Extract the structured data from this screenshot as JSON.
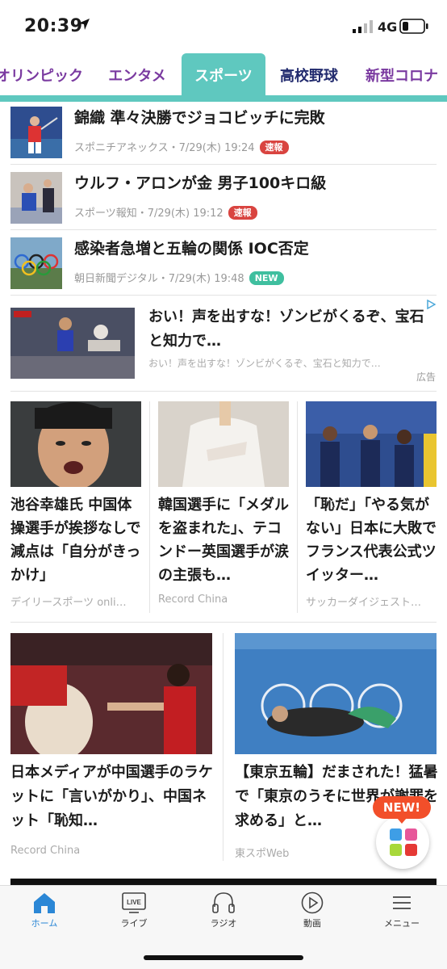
{
  "status_bar": {
    "time": "20:39",
    "network": "4G"
  },
  "tabs": [
    {
      "label": "オリンピック"
    },
    {
      "label": "エンタメ"
    },
    {
      "label": "スポーツ",
      "active": true
    },
    {
      "label": "高校野球"
    },
    {
      "label": "新型コロナ"
    }
  ],
  "news_list": [
    {
      "title": "錦織 準々決勝でジョコビッチに完敗",
      "source": "スポニチアネックス・7/29(木) 19:24",
      "badge": "速報"
    },
    {
      "title": "ウルフ・アロンが金 男子100キロ級",
      "source": "スポーツ報知・7/29(木) 19:12",
      "badge": "速報"
    },
    {
      "title": "感染者急増と五輪の関係 IOC否定",
      "source": "朝日新聞デジタル・7/29(木) 19:48",
      "badge": "NEW"
    }
  ],
  "ad": {
    "title": "おい！声を出すな！ゾンビがくるぞ、宝石と知力で…",
    "description": "おい！声を出すな！ゾンビがくるぞ、宝石と知力で…",
    "label": "広告"
  },
  "cards_3col": [
    {
      "title": "池谷幸雄氏 中国体操選手が挨拶なしで減点は「自分がきっかけ」",
      "source": "デイリースポーツ onli…"
    },
    {
      "title": "韓国選手に「メダルを盗まれた」、テコンドー英国選手が涙の主張も…",
      "source": "Record China"
    },
    {
      "title": "「恥だ」「やる気がない」日本に大敗でフランス代表公式ツイッター…",
      "source": "サッカーダイジェスト…"
    }
  ],
  "cards_2col": [
    {
      "title": "日本メディアが中国選手のラケットに「言いがかり」、中国ネット「恥知…",
      "source": "Record China"
    },
    {
      "title": "【東京五輪】だまされた！猛暑で「東京のうそに世界が謝罪を求める」と…",
      "source": "東スポWeb"
    }
  ],
  "fab": {
    "badge": "NEW!"
  },
  "bottom_nav": [
    {
      "label": "ホーム",
      "icon": "home-icon",
      "active": true
    },
    {
      "label": "ライブ",
      "icon": "live-tv-icon"
    },
    {
      "label": "ラジオ",
      "icon": "headphones-icon"
    },
    {
      "label": "動画",
      "icon": "play-icon"
    },
    {
      "label": "メニュー",
      "icon": "menu-icon"
    }
  ],
  "colors": {
    "accent": "#5fc8bf",
    "tab_text": "#7a3aa0",
    "breaking_badge": "#d94440",
    "new_badge": "#3fbf9f",
    "nav_active": "#2b87d6",
    "fab_badge": "#f24f2a"
  }
}
